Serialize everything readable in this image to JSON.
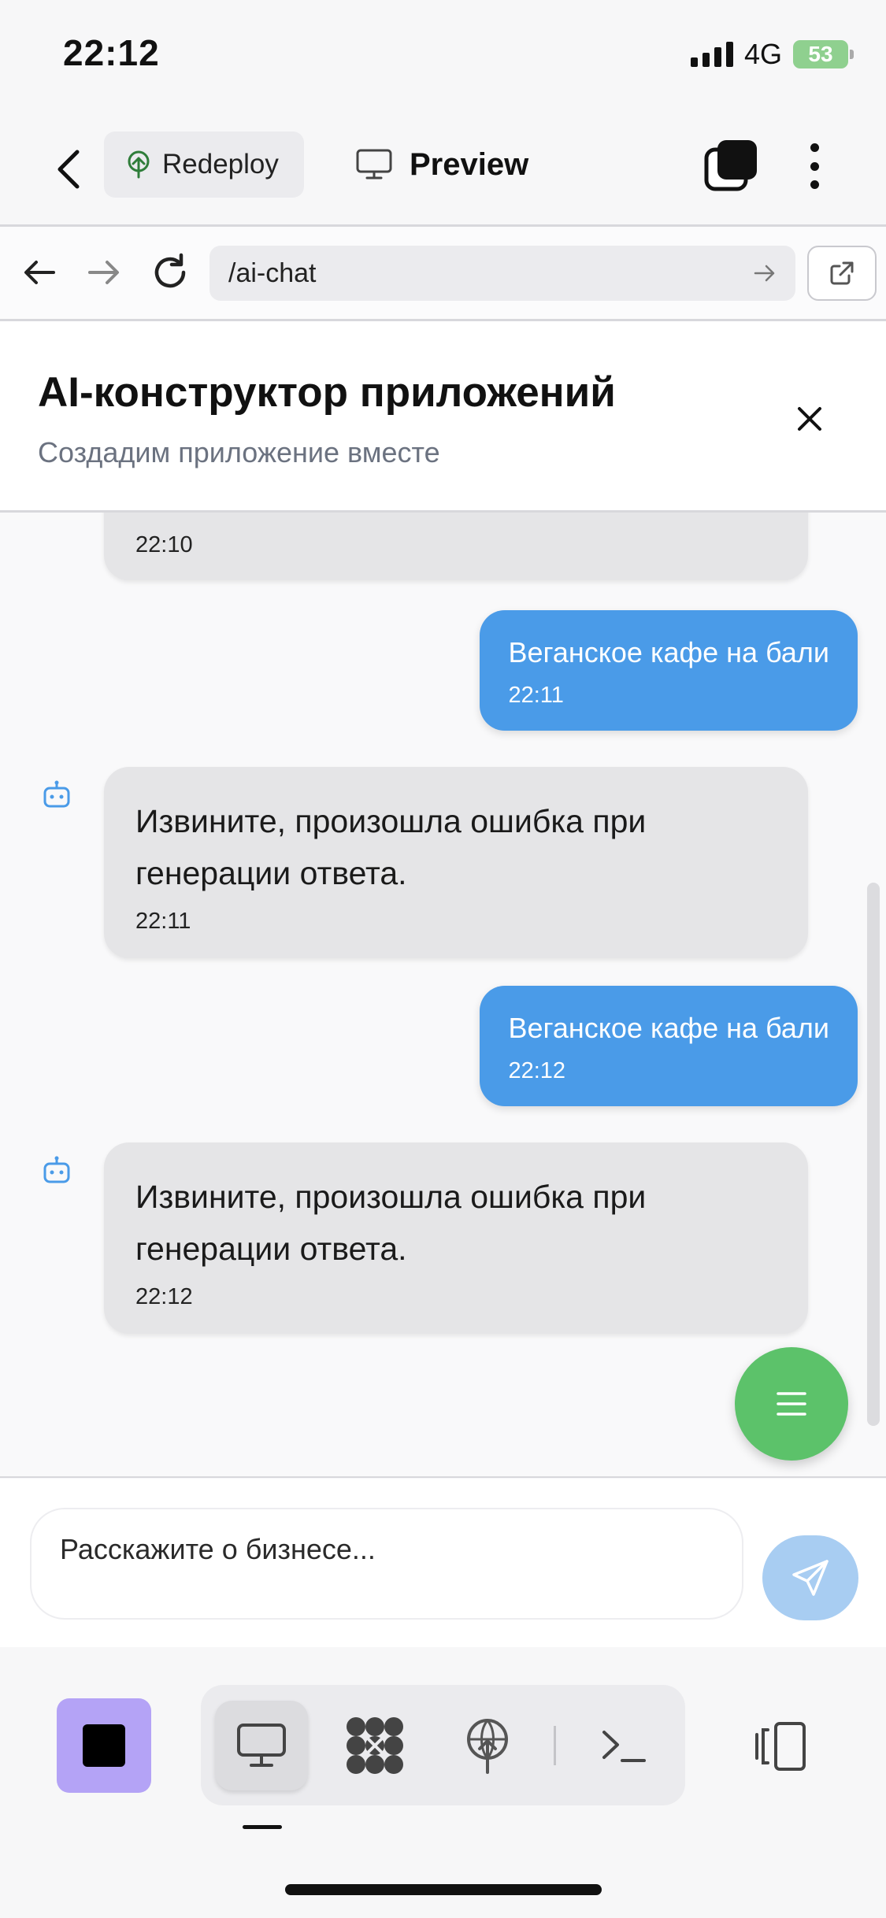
{
  "status_bar": {
    "time": "22:12",
    "network": "4G",
    "battery": "53"
  },
  "toolbar": {
    "redeploy_label": "Redeploy",
    "preview_label": "Preview"
  },
  "browser": {
    "url": "/ai-chat"
  },
  "chat": {
    "title": "AI-конструктор приложений",
    "subtitle": "Создадим приложение вместе",
    "messages": [
      {
        "role": "assistant",
        "text": "",
        "time": "22:10"
      },
      {
        "role": "user",
        "text": "Веганское кафе на бали",
        "time": "22:11"
      },
      {
        "role": "assistant",
        "text": "Извините, произошла ошибка при генерации ответа.",
        "time": "22:11"
      },
      {
        "role": "user",
        "text": "Веганское кафе на бали",
        "time": "22:12"
      },
      {
        "role": "assistant",
        "text": "Извините, произошла ошибка при генерации ответа.",
        "time": "22:12"
      }
    ]
  },
  "composer": {
    "placeholder": "Расскажите о бизнесе..."
  },
  "icons": {
    "back": "chevron-left-icon",
    "redeploy": "tree-deploy-icon",
    "preview": "monitor-icon",
    "windows": "stacked-windows-icon",
    "more": "vertical-dots-icon",
    "nav_back": "arrow-left-icon",
    "nav_forward": "arrow-right-icon",
    "reload": "reload-icon",
    "go": "arrow-right-icon",
    "external": "external-link-icon",
    "close": "close-icon",
    "bot": "bot-icon",
    "menu": "menu-icon",
    "send": "send-icon",
    "stop": "stop-icon",
    "tools": [
      "monitor-icon",
      "integrations-icon",
      "deploy-icon",
      "terminal-icon"
    ],
    "layout": "layout-toggle-icon"
  },
  "colors": {
    "user_bubble": "#4a9be8",
    "assistant_bubble": "#e5e5e7",
    "fab": "#5cc26a",
    "send_button": "#a8cdf2",
    "stop_button": "#b4a3f6",
    "battery": "#8fd08f"
  }
}
